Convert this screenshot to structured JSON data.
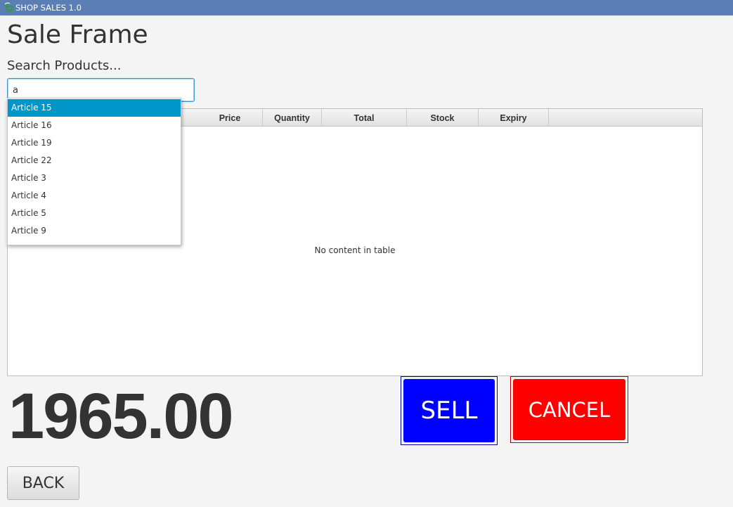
{
  "window": {
    "title": "SHOP SALES 1.0",
    "icon": "app-cart-icon"
  },
  "page": {
    "title": "Sale Frame"
  },
  "search": {
    "label": "Search Products...",
    "value": "a",
    "suggestions": [
      "Article 15",
      "Article 16",
      "Article 19",
      "Article 22",
      "Article 3",
      "Article 4",
      "Article 5",
      "Article 9"
    ],
    "selected_index": 0
  },
  "table": {
    "columns": [
      "Price",
      "Quantity",
      "Total",
      "Stock",
      "Expiry"
    ],
    "rows": [],
    "empty_message": "No content in table"
  },
  "total": {
    "value": "1965.00"
  },
  "actions": {
    "sell_label": "SELL",
    "cancel_label": "CANCEL",
    "back_label": "BACK"
  },
  "colors": {
    "titlebar": "#5b7fb5",
    "sell": "#0000ff",
    "cancel": "#ff0000",
    "selection": "#0096c9"
  }
}
